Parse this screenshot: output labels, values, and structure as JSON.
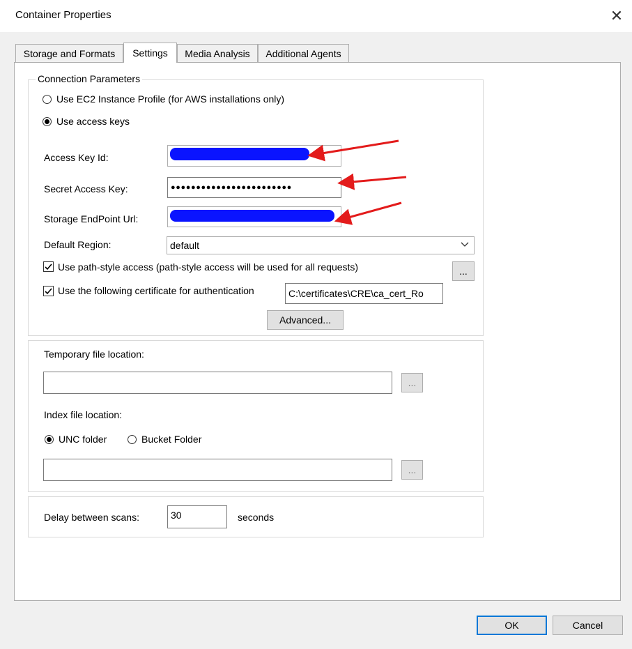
{
  "window": {
    "title": "Container Properties"
  },
  "tabs": [
    {
      "label": "Storage and Formats",
      "active": false
    },
    {
      "label": "Settings",
      "active": true
    },
    {
      "label": "Media Analysis",
      "active": false
    },
    {
      "label": "Additional Agents",
      "active": false
    }
  ],
  "connection": {
    "legend": "Connection Parameters",
    "ec2_label": "Use EC2 Instance Profile (for AWS installations only)",
    "access_keys_label": "Use access keys",
    "access_key_id_label": "Access Key Id:",
    "secret_access_key_label": "Secret Access Key:",
    "secret_access_key_value": "●●●●●●●●●●●●●●●●●●●●●●●●",
    "endpoint_url_label": "Storage EndPoint Url:",
    "default_region_label": "Default Region:",
    "default_region_value": "default",
    "path_style_label": "Use path-style access (path-style access will be used for all requests)",
    "certificate_label": "Use the following certificate for authentication",
    "certificate_value": "C:\\certificates\\CRE\\ca_cert_Ro",
    "browse_label": "...",
    "advanced_label": "Advanced..."
  },
  "files": {
    "temp_location_label": "Temporary file location:",
    "temp_location_value": "",
    "index_location_label": "Index file location:",
    "unc_folder_label": "UNC folder",
    "bucket_folder_label": "Bucket Folder",
    "index_location_value": "",
    "browse_label": "..."
  },
  "scans": {
    "delay_label": "Delay between scans:",
    "delay_value": "30",
    "seconds_label": "seconds"
  },
  "footer": {
    "ok_label": "OK",
    "cancel_label": "Cancel"
  },
  "colors": {
    "redaction": "#0a14ff",
    "annotation_arrow": "#e31b1b",
    "focus_accent": "#0078d7"
  }
}
